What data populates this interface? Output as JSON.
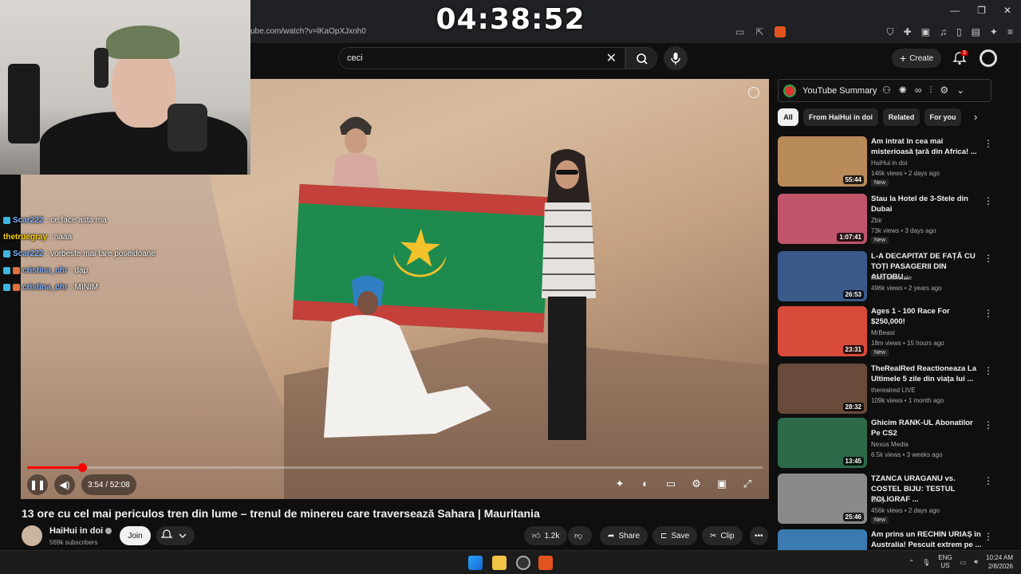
{
  "timer": "04:38:52",
  "browser": {
    "url": "ube.com/watch?v=lKaOpXJxnh0"
  },
  "yt": {
    "search_value": "ceci",
    "create_label": "Create",
    "notif_count": "3"
  },
  "chat": [
    {
      "name": "Scar222",
      "msg": "ce face asta ma",
      "name_color": "#7fb0ff"
    },
    {
      "name": "thetruegray",
      "msg": "naaa",
      "name_color": "#ffd400"
    },
    {
      "name": "Scar222",
      "msg": "vorbeste mai tare poseidoane",
      "name_color": "#7fb0ff"
    },
    {
      "name": "cristina_chr",
      "msg": "dap",
      "name_color": "#7fb0ff"
    },
    {
      "name": "cristina_chr",
      "msg": "MINIM",
      "name_color": "#7fb0ff"
    }
  ],
  "player": {
    "time": "3:54 / 52:08",
    "progress": 0.075
  },
  "video": {
    "title": "13 ore cu cel mai periculos tren din lume – trenul de minereu care traversează Sahara | Mauritania",
    "channel": "HaiHui in doi",
    "subscribers": "569k subscribers",
    "join_label": "Join",
    "likes": "1.2k",
    "share_label": "Share",
    "save_label": "Save",
    "clip_label": "Clip"
  },
  "extension": {
    "title": "YouTube Summary"
  },
  "chips": [
    "All",
    "From HaiHui in doi",
    "Related",
    "For you"
  ],
  "recommendations": [
    {
      "title": "Am intrat în cea mai misterioasă țară din Africa! ...",
      "channel": "HaiHui in doi",
      "meta": "146k views • 2 days ago",
      "badge": "New",
      "duration": "55:44",
      "thumb": "#b98a5a"
    },
    {
      "title": "Stau la Hotel de 3-Stele din Dubai",
      "channel": "Zbir",
      "meta": "73k views • 3 days ago",
      "badge": "New",
      "duration": "1:07:41",
      "thumb": "#c0546a"
    },
    {
      "title": "L-A DECAPITAT DE FAȚĂ CU TOȚI PASAGERII DIN AUTOBU...",
      "channel": "Minti criminale",
      "meta": "496k views • 2 years ago",
      "badge": "",
      "duration": "26:53",
      "thumb": "#3a5a8a"
    },
    {
      "title": "Ages 1 - 100 Race For $250,000!",
      "channel": "MrBeast",
      "meta": "18m views • 15 hours ago",
      "badge": "New",
      "duration": "23:31",
      "thumb": "#d84a3a"
    },
    {
      "title": "TheRealRed Reactioneaza La Ultimele 5 zile din viața lui ...",
      "channel": "therealred LIVE",
      "meta": "109k views • 1 month ago",
      "badge": "",
      "duration": "28:32",
      "thumb": "#6a4a3a"
    },
    {
      "title": "Ghicim RANK-UL Abonatilor Pe CS2",
      "channel": "Nexus Media",
      "meta": "6.5k views • 3 weeks ago",
      "badge": "",
      "duration": "13:45",
      "thumb": "#2c6a4a"
    },
    {
      "title": "TZANCA URAGANU vs. COSTEL BIJU: TESTUL POLIGRAF ...",
      "channel": "Selly",
      "meta": "456k views • 2 days ago",
      "badge": "New",
      "duration": "25:46",
      "thumb": "#8a8a8a"
    },
    {
      "title": "Am prins un RECHIN URIAȘ în Australia! Pescuit extrem pe ...",
      "channel": "",
      "meta": "",
      "badge": "",
      "duration": "",
      "thumb": "#3a7ab0"
    }
  ],
  "taskbar": {
    "lang": "ENG",
    "region": "US",
    "time": "10:24 AM",
    "date": "2/8/2026"
  }
}
